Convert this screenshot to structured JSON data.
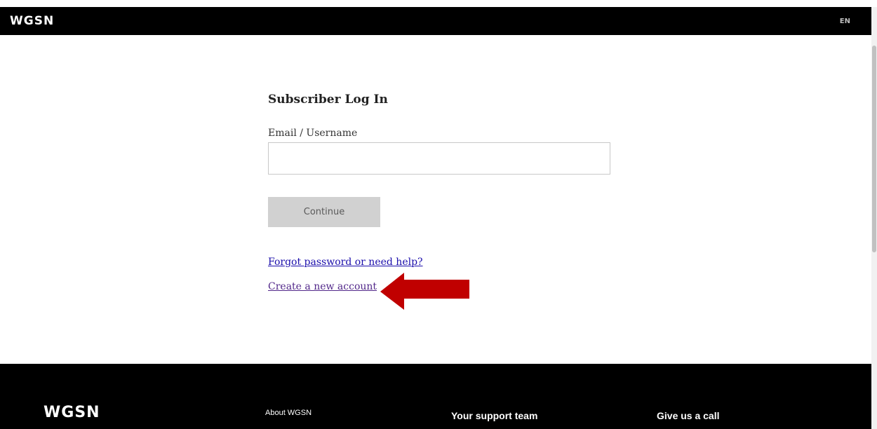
{
  "header": {
    "logo": "WGSN",
    "language": "EN"
  },
  "login": {
    "title": "Subscriber Log In",
    "email_label": "Email / Username",
    "email_value": "",
    "continue_label": "Continue",
    "forgot_link": "Forgot password or need help?",
    "create_link": "Create a new account"
  },
  "footer": {
    "logo": "WGSN",
    "about_link": "About WGSN",
    "support_heading": "Your support team",
    "call_heading": "Give us a call"
  },
  "colors": {
    "header_bg": "#000000",
    "button_bg": "#d1d1d1",
    "link": "#1a0dab",
    "visited_link": "#52288a",
    "annotation_arrow": "#c00000"
  },
  "icons": {
    "annotation": "arrow-left-icon"
  }
}
